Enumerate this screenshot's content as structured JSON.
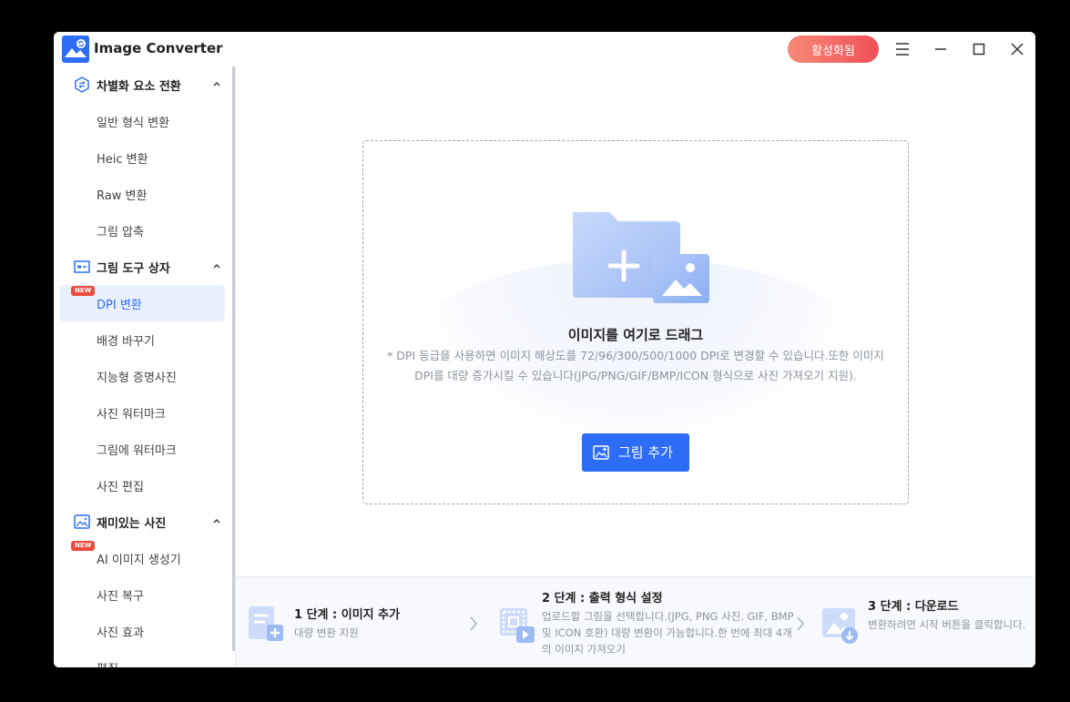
{
  "app": {
    "title": "Image Converter",
    "activate_label": "활성화됨",
    "accent_color": "#2d6df6"
  },
  "window_controls": {
    "icons": [
      "menu-icon",
      "minimize-icon",
      "maximize-icon",
      "close-icon"
    ]
  },
  "sidebar": {
    "sections": [
      {
        "label": "차별화 요소 전환",
        "icon": "convert-icon",
        "items": [
          "일반 형식 변환",
          "Heic 변환",
          "Raw 변환",
          "그림 압축"
        ]
      },
      {
        "label": "그림 도구 상자",
        "icon": "toolbox-icon",
        "items": [
          "DPI 변환",
          "배경 바꾸기",
          "지능형 증명사진",
          "사진 워터마크",
          "그림에 워터마크",
          "사진 편집"
        ]
      },
      {
        "label": "재미있는 사진",
        "icon": "fun-image-icon",
        "items": [
          "AI 이미지 생성기",
          "사진 복구",
          "사진 효과",
          "편집"
        ]
      }
    ],
    "active_item": "DPI 변환",
    "new_badge": "NEW"
  },
  "dropzone": {
    "title": "이미지를 여기로 드래그",
    "description": "* DPI 등급을 사용하면 이미지 해상도를 72/96/300/500/1000 DPI로 변경할 수 있습니다.또한 이미지 DPI를 대량 증가시킬 수 있습니다(JPG/PNG/GIF/BMP/ICON 형식으로 사진 가져오기 지원).",
    "add_button": "그림 추가"
  },
  "steps": [
    {
      "title": "1 단계 : 이미지 추가",
      "desc": "대량 변환 지원"
    },
    {
      "title": "2 단계 : 출력 형식 설정",
      "desc": "업로드할 그림을 선택합니다.(JPG, PNG 사진. GIF, BMP 및 ICON 호환) 대량 변환이 가능합니다.한 번에 최대 4개의 이미지 가져오기"
    },
    {
      "title": "3 단계 : 다운로드",
      "desc": "변환하려면 시작 버튼을 클릭합니다."
    }
  ]
}
